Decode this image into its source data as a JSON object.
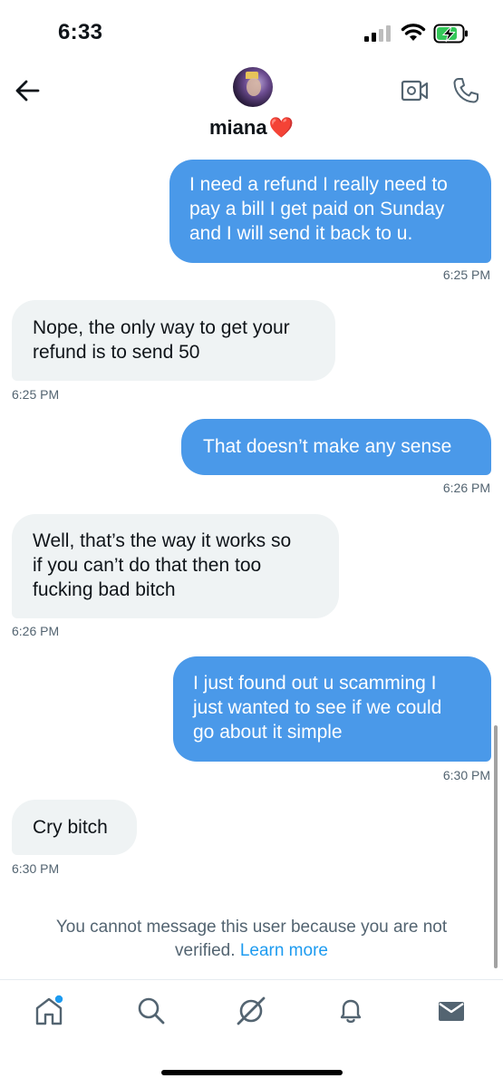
{
  "status_bar": {
    "time": "6:33"
  },
  "header": {
    "contact_name": "miana",
    "heart": "❤️"
  },
  "messages": [
    {
      "lines": [
        "I need a refund I really need to",
        "pay a bill I get paid on Sunday",
        "and I will send it back to u."
      ],
      "time": "6:25 PM"
    },
    {
      "lines": [
        "Nope, the only way to get your",
        "refund is to send 50"
      ],
      "time": "6:25 PM"
    },
    {
      "lines": [
        "That doesn’t make any sense"
      ],
      "time": "6:26 PM"
    },
    {
      "lines": [
        "Well, that’s the way it works so",
        "if you can’t do that then too",
        "fucking bad bitch"
      ],
      "time": "6:26 PM"
    },
    {
      "lines": [
        "I just found out u scamming I",
        "just wanted to see if we could",
        "go about it simple"
      ],
      "time": "6:30 PM"
    },
    {
      "lines": [
        "Cry bitch"
      ],
      "time": "6:30 PM"
    }
  ],
  "notice": {
    "line1": "You cannot message this user because you are not",
    "line2": "verified.",
    "link": "Learn more"
  },
  "icons": {
    "back": "arrow-left-icon",
    "video": "video-call-icon",
    "phone": "phone-icon",
    "home": "home-icon",
    "search": "search-icon",
    "grok": "grok-icon",
    "notifications": "bell-icon",
    "messages": "envelope-icon"
  },
  "colors": {
    "outgoing_bubble": "#4a99e9",
    "incoming_bubble": "#eff3f4",
    "link": "#1d9bf0",
    "notification_dot": "#1d9bf0"
  }
}
